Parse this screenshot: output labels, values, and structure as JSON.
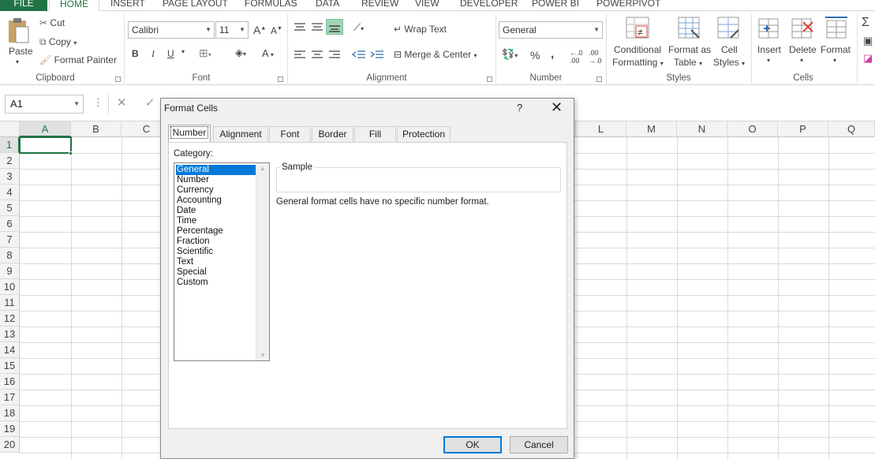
{
  "ribbon_tabs": [
    "FILE",
    "HOME",
    "INSERT",
    "PAGE LAYOUT",
    "FORMULAS",
    "DATA",
    "REVIEW",
    "VIEW",
    "DEVELOPER",
    "POWER BI",
    "POWERPIVOT"
  ],
  "clipboard": {
    "paste": "Paste",
    "cut": "Cut",
    "copy": "Copy",
    "format_painter": "Format Painter",
    "label": "Clipboard"
  },
  "font": {
    "name": "Calibri",
    "size": "11",
    "bold": "B",
    "italic": "I",
    "underline": "U",
    "label": "Font"
  },
  "alignment": {
    "wrap": "Wrap Text",
    "merge": "Merge & Center",
    "label": "Alignment"
  },
  "number": {
    "format": "General",
    "percent": "%",
    "comma": ",",
    "label": "Number"
  },
  "styles": {
    "conditional": "Conditional",
    "conditional2": "Formatting",
    "format_as": "Format as",
    "format_as2": "Table",
    "cell": "Cell",
    "cell2": "Styles",
    "label": "Styles"
  },
  "cells": {
    "insert": "Insert",
    "delete": "Delete",
    "format": "Format",
    "label": "Cells"
  },
  "formula_bar": {
    "name_box": "A1"
  },
  "columns": [
    "A",
    "B",
    "C",
    "L",
    "M",
    "N",
    "O",
    "P",
    "Q"
  ],
  "rows": [
    "1",
    "2",
    "3",
    "4",
    "5",
    "6",
    "7",
    "8",
    "9",
    "10",
    "11",
    "12",
    "13",
    "14",
    "15",
    "16",
    "17",
    "18",
    "19",
    "20"
  ],
  "dialog": {
    "title": "Format Cells",
    "help": "?",
    "close": "✕",
    "tabs": [
      "Number",
      "Alignment",
      "Font",
      "Border",
      "Fill",
      "Protection"
    ],
    "category_label": "Category:",
    "categories": [
      "General",
      "Number",
      "Currency",
      "Accounting",
      "Date",
      "Time",
      "Percentage",
      "Fraction",
      "Scientific",
      "Text",
      "Special",
      "Custom"
    ],
    "selected_category": "General",
    "sample_label": "Sample",
    "description": "General format cells have no specific number format.",
    "ok": "OK",
    "cancel": "Cancel"
  },
  "colors": {
    "excel_green": "#217346",
    "selection_blue": "#0078d7"
  }
}
